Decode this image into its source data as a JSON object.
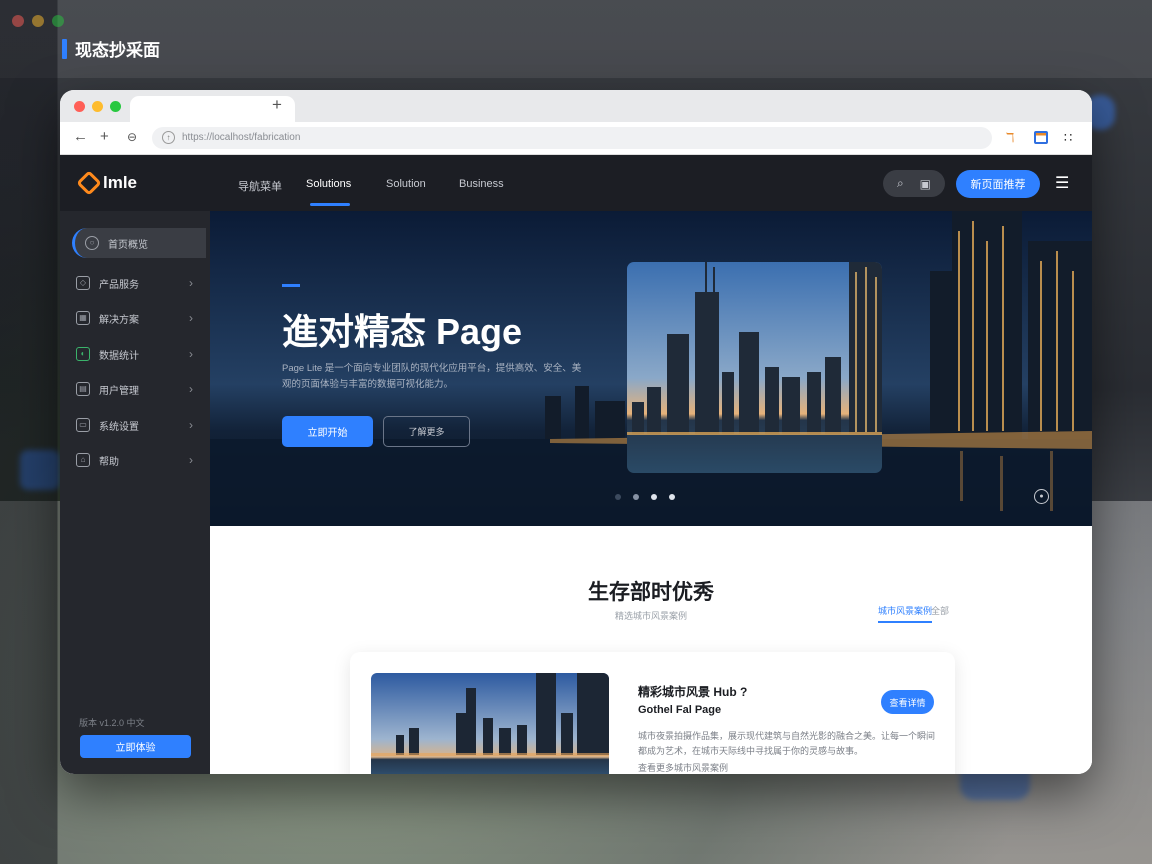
{
  "caption": "现态抄采面",
  "browser": {
    "url": "https://localhost/fabrication",
    "new_tab": "+",
    "back": "←",
    "forward": "→"
  },
  "app": {
    "logo": "lmle",
    "nav": [
      "导航菜单",
      "Solutions",
      "Solution",
      "Business"
    ],
    "active_nav": 1,
    "search_icons": [
      "search-icon",
      "bell-icon"
    ],
    "cta": "新页面推荐"
  },
  "sidebar": {
    "items": [
      {
        "label": "首页概览",
        "icon": "search-icon"
      },
      {
        "label": "产品服务",
        "icon": "package-icon"
      },
      {
        "label": "解决方案",
        "icon": "grid-icon"
      },
      {
        "label": "数据统计",
        "icon": "chart-icon"
      },
      {
        "label": "用户管理",
        "icon": "user-icon"
      },
      {
        "label": "系统设置",
        "icon": "settings-icon"
      },
      {
        "label": "帮助",
        "icon": "help-icon"
      }
    ],
    "footer_text": "版本 v1.2.0 中文",
    "footer_button": "立即体验"
  },
  "hero": {
    "title": "進对精态 Page",
    "description": "Page Lite 是一个面向专业团队的现代化应用平台，提供高效、安全、美观的页面体验与丰富的数据可视化能力。",
    "primary_button": "立即开始",
    "secondary_button": "了解更多",
    "slide_count": 4,
    "active_slide": 2
  },
  "section": {
    "title": "生存部时优秀",
    "subtitle": "精选城市风景案例",
    "tabs": [
      "城市风景案例",
      "全部"
    ],
    "card": {
      "title": "精彩城市风景 Hub ?",
      "subtitle": "Gothel Fal Page",
      "button": "查看详情",
      "description": "城市夜景拍摄作品集，展示现代建筑与自然光影的融合之美。让每一个瞬间都成为艺术，在城市天际线中寻找属于你的灵感与故事。",
      "more": "查看更多城市风景案例"
    }
  },
  "colors": {
    "accent": "#2f80ff",
    "sidebar_bg": "#25272d",
    "topnav_bg": "#1c1e24",
    "logo_accent": "#ff8a1c"
  }
}
